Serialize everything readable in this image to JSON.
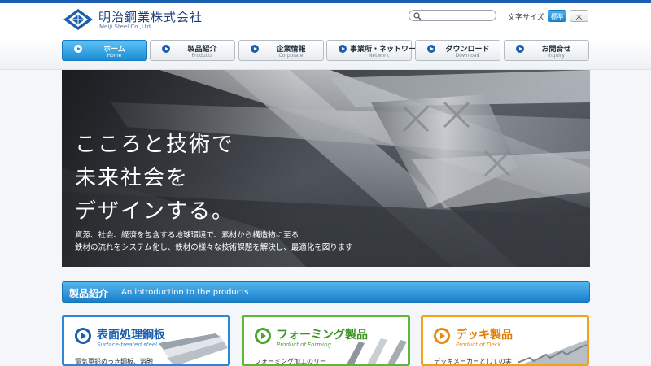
{
  "header": {
    "company_name": "明治鋼業株式会社",
    "company_name_en": "Meiji Steel Co.,Ltd.",
    "search_placeholder": "",
    "font_size_label": "文字サイズ",
    "font_size_options": [
      "標準",
      "大"
    ],
    "font_size_selected": "標準"
  },
  "nav": {
    "items": [
      {
        "label": "ホーム",
        "sub": "Home",
        "active": true
      },
      {
        "label": "製品紹介",
        "sub": "Products",
        "active": false
      },
      {
        "label": "企業情報",
        "sub": "Corporate",
        "active": false
      },
      {
        "label": "事業所・ネットワーク",
        "sub": "Network",
        "active": false
      },
      {
        "label": "ダウンロード",
        "sub": "Download",
        "active": false
      },
      {
        "label": "お問合せ",
        "sub": "Inquiry",
        "active": false
      }
    ]
  },
  "hero": {
    "headline": [
      "こころと技術で",
      "未来社会を",
      "デザインする。"
    ],
    "subtext": [
      "資源、社会、経済を包含する地球環境で、素材から構造物に至る",
      "鉄材の流れをシステム化し、鉄材の様々な技術課題を解決し、最適化を図ります"
    ]
  },
  "products_section": {
    "title": "製品紹介",
    "title_en": "An introduction to the products"
  },
  "cards": [
    {
      "title": "表面処理鋼板",
      "subtitle": "Surface-treated steel sheet",
      "body": "電気亜鉛めっき鋼板、溶融",
      "color": "#2d87d6"
    },
    {
      "title": "フォーミング製品",
      "subtitle": "Product of Forming",
      "body": "フォーミング加工のリー",
      "color": "#5cb83b"
    },
    {
      "title": "デッキ製品",
      "subtitle": "Product of Deck",
      "body": "デッキメーカーとしての実",
      "color": "#f0a21c"
    }
  ],
  "colors": {
    "brand_blue": "#1a5fb0",
    "accent_blue": "#1a8bd5"
  }
}
